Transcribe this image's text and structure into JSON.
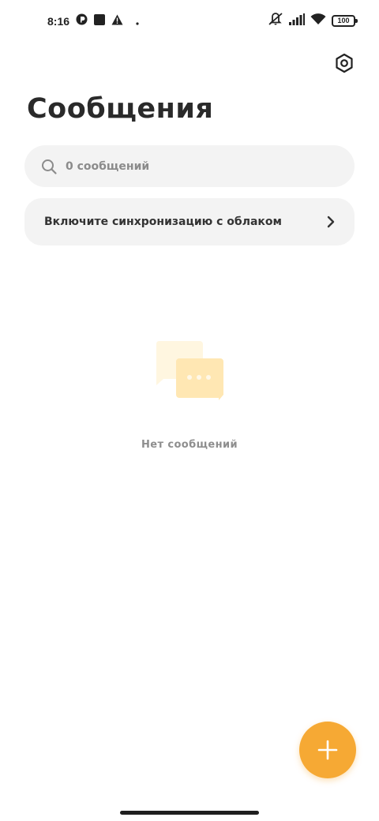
{
  "status_bar": {
    "time": "8:16",
    "battery": "100",
    "icons": [
      "app-icon",
      "square-icon",
      "warning-icon",
      "dot-icon",
      "mute-icon",
      "signal-icon",
      "wifi-icon",
      "battery-icon"
    ]
  },
  "header": {
    "title": "Сообщения",
    "settings_icon": "hexagon-settings-icon"
  },
  "search": {
    "placeholder": "0 сообщений"
  },
  "sync_banner": {
    "label": "Включите синхронизацию с облаком"
  },
  "empty_state": {
    "message": "Нет сообщений",
    "icon": "chat-bubbles-icon"
  },
  "fab": {
    "icon": "plus-icon"
  },
  "colors": {
    "accent": "#f6a934",
    "surface": "#f3f3f3",
    "bubble_back": "#fff6e0",
    "bubble_front": "#ffe7b3"
  }
}
